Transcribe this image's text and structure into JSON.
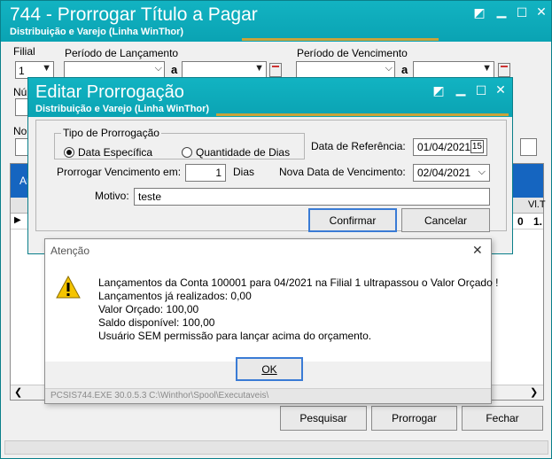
{
  "main": {
    "title": "744 - Prorrogar Título a Pagar",
    "subtitle": "Distribuição e Varejo (Linha WinThor)",
    "filial_label": "Filial",
    "filial_value": "1",
    "periodo_lancamento_label": "Período de Lançamento",
    "periodo_vencimento_label": "Período de Vencimento",
    "a_label": "a",
    "numero_label_partial": "Nú",
    "nota_label_partial": "No",
    "grid_header_partial": "Ar",
    "grid_col_right": "Vl.T",
    "grid_cell_zero": "0",
    "grid_cell_one": "1.",
    "buttons": {
      "pesquisar": "Pesquisar",
      "prorrogar": "Prorrogar",
      "fechar": "Fechar"
    }
  },
  "edit": {
    "title": "Editar Prorrogação",
    "subtitle": "Distribuição e Varejo (Linha WinThor)",
    "tipo_group_label": "Tipo de Prorrogação",
    "radio_data": "Data Específica",
    "radio_qtd": "Quantidade de Dias",
    "data_referencia_label": "Data de Referência:",
    "data_referencia_value": "01/04/2021",
    "prorrogar_label": "Prorrogar Vencimento em:",
    "prorrogar_value": "1",
    "dias_label": "Dias",
    "nova_data_label": "Nova Data de Vencimento:",
    "nova_data_value": "02/04/2021",
    "motivo_label": "Motivo:",
    "motivo_value": "teste",
    "confirmar": "Confirmar",
    "cancelar": "Cancelar"
  },
  "alert": {
    "title": "Atenção",
    "lines": [
      "Lançamentos da Conta 100001 para 04/2021 na Filial 1 ultrapassou o Valor Orçado !",
      "Lançamentos já realizados: 0,00",
      "Valor Orçado: 100,00",
      "Saldo disponível: 100,00",
      "Usuário SEM permissão para lançar acima do orçamento."
    ],
    "ok": "OK",
    "status": "PCSIS744.EXE 30.0.5.3 C:\\Winthor\\Spool\\Executaveis\\"
  },
  "colors": {
    "titlebar": "#0aa3b3",
    "gold": "#c8a33a",
    "grid_header": "#1565c0",
    "focus": "#3a7bd5"
  }
}
